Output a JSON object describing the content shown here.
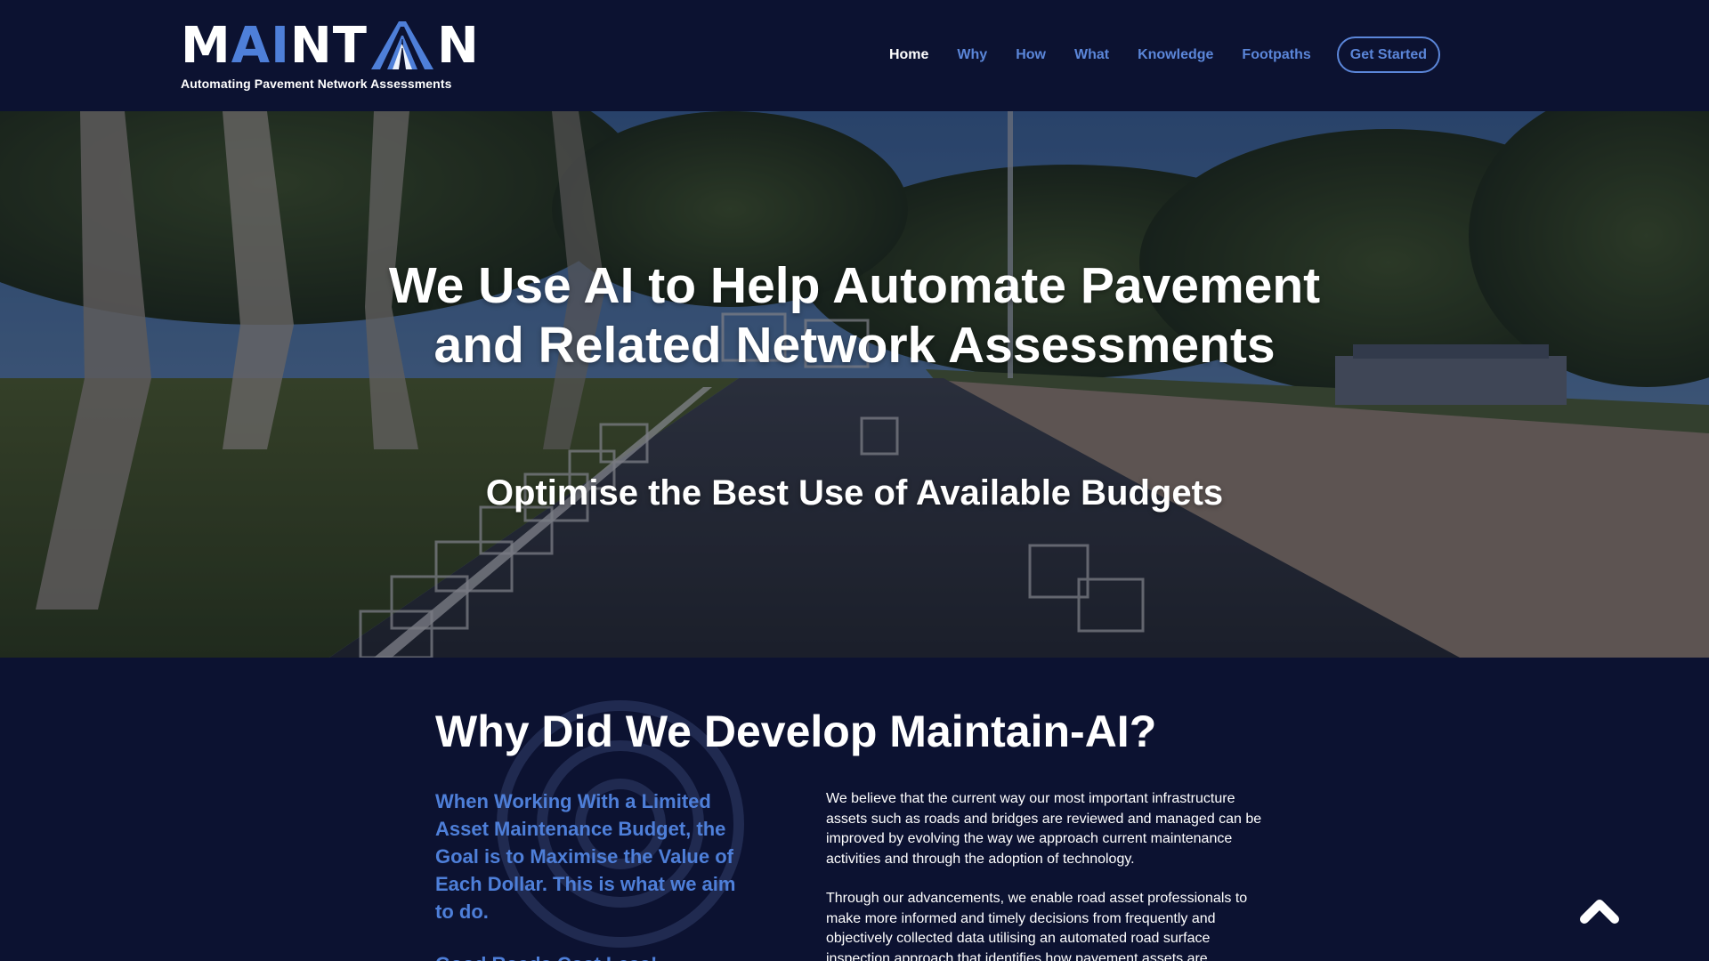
{
  "brand": {
    "letters_left": "M",
    "letters_ai": "AI",
    "letters_mid": "NT",
    "letters_right": "N",
    "tagline": "Automating Pavement Network Assessments",
    "accent": "#4e7fd9",
    "background": "#0c1231"
  },
  "nav": {
    "items": [
      {
        "label": "Home",
        "active": true
      },
      {
        "label": "Why"
      },
      {
        "label": "How"
      },
      {
        "label": "What"
      },
      {
        "label": "Knowledge"
      },
      {
        "label": "Footpaths"
      }
    ],
    "cta": "Get Started"
  },
  "hero": {
    "title_line1": "We Use AI to Help Automate Pavement",
    "title_line2": "and Related Network Assessments",
    "subtitle": "Optimise the Best Use of Available Budgets",
    "image": "road-with-ai-detection-boxes"
  },
  "why": {
    "heading": "Why Did We Develop Maintain-AI?",
    "lead": "When Working With a Limited Asset Maintenance Budget, the Goal is to Maximise the Value of Each Dollar. This is what we aim to do.",
    "lead_next": "Good Roads Cost Less!",
    "paragraph1": "We believe that the current way our most important infrastructure assets such as roads and bridges are reviewed and managed can be improved by evolving the way we approach current maintenance activities and through the adoption of technology.",
    "paragraph2": "Through our advancements, we enable road asset professionals to make more informed and timely decisions from frequently and objectively collected data utilising an automated road surface inspection approach that identifies how pavement assets are"
  },
  "scroll_top": {
    "icon": "chevron-up-icon"
  }
}
